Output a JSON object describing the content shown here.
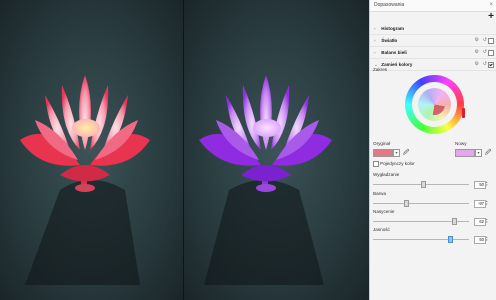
{
  "panel": {
    "title": "Dopasowania",
    "add_symbol": "+",
    "close_symbol": "×",
    "sections": [
      {
        "label": "Histogram",
        "chevron": "›"
      },
      {
        "label": "Światło",
        "chevron": "›"
      },
      {
        "label": "Balans bieli",
        "chevron": "›"
      },
      {
        "label": "Zamień kolory",
        "chevron": "⌄"
      }
    ],
    "zakres_label": "Zakres",
    "oryginal_label": "Oryginał",
    "nowy_label": "Nowy",
    "single_color_label": "Pojedynczy kolor",
    "sliders": [
      {
        "label": "Wygładzanie",
        "value": "50"
      },
      {
        "label": "Barwa",
        "value": "-97"
      },
      {
        "label": "Nasycenie",
        "value": "62"
      },
      {
        "label": "Jasność",
        "value": "50"
      }
    ]
  },
  "colors": {
    "original_swatch": "#e07a86",
    "new_swatch": "#e6a6ee",
    "wheel_marker": "#e01b2b"
  }
}
